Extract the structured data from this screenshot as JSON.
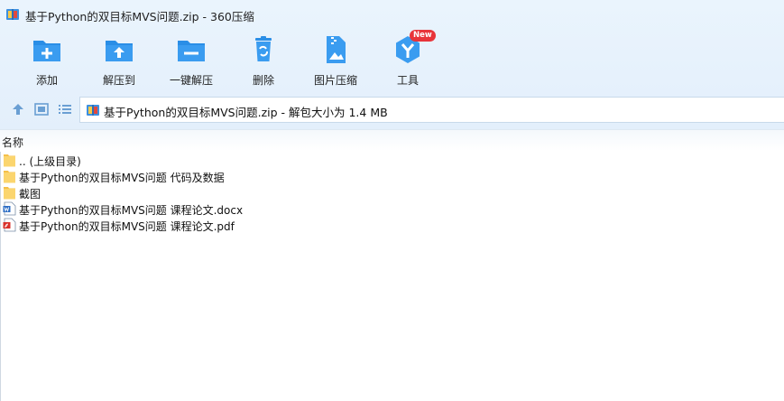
{
  "window": {
    "title": "基于Python的双目标MVS问题.zip - 360压缩"
  },
  "toolbar": {
    "items": [
      {
        "label": "添加",
        "icon": "folder-add-icon"
      },
      {
        "label": "解压到",
        "icon": "folder-extract-icon"
      },
      {
        "label": "一键解压",
        "icon": "folder-oneclick-extract-icon"
      },
      {
        "label": "删除",
        "icon": "recycle-bin-icon"
      },
      {
        "label": "图片压缩",
        "icon": "image-compress-icon"
      },
      {
        "label": "工具",
        "icon": "tools-cube-icon",
        "badge": "New"
      }
    ]
  },
  "address": {
    "text": "基于Python的双目标MVS问题.zip - 解包大小为 1.4 MB"
  },
  "list": {
    "header_name": "名称",
    "rows": [
      {
        "name": ".. (上级目录)",
        "icon": "folder-icon"
      },
      {
        "name": "基于Python的双目标MVS问题 代码及数据",
        "icon": "folder-icon"
      },
      {
        "name": "截图",
        "icon": "folder-icon"
      },
      {
        "name": "基于Python的双目标MVS问题 课程论文.docx",
        "icon": "word-doc-icon"
      },
      {
        "name": "基于Python的双目标MVS问题 课程论文.pdf",
        "icon": "pdf-icon"
      }
    ]
  },
  "colors": {
    "accent": "#2a8ee6",
    "badge": "#e8343a",
    "folder": "#f5c04a"
  }
}
